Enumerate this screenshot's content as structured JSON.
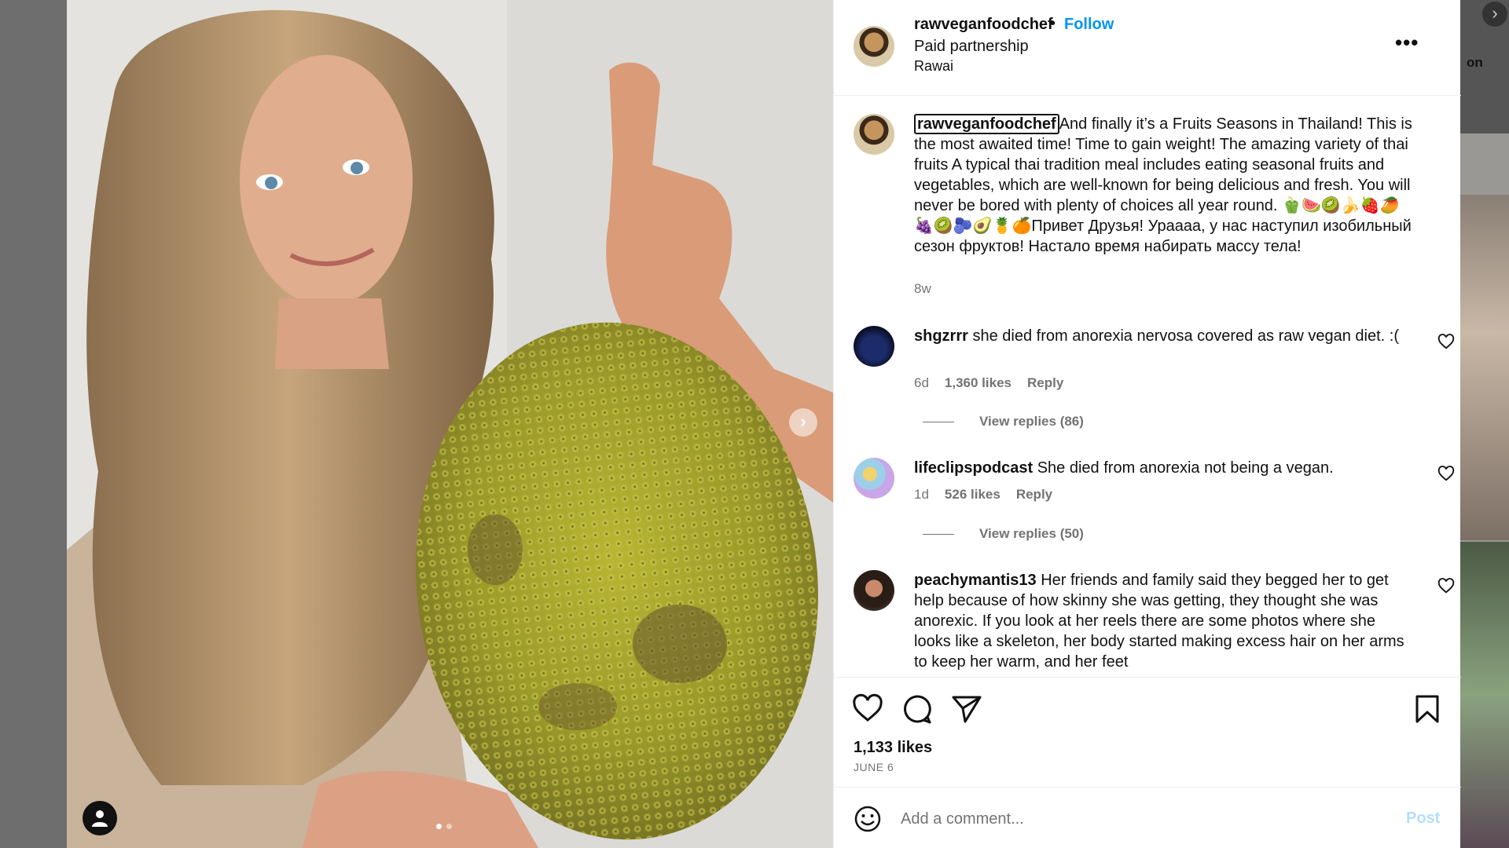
{
  "header": {
    "username": "rawveganfoodchef",
    "separator": "•",
    "follow_label": "Follow",
    "subtitle": "Paid partnership",
    "location": "Rawai",
    "more_label": "•••"
  },
  "caption": {
    "username": "rawveganfoodchef",
    "text": "And finally it’s a Fruits Seasons in Thailand! This is the most awaited time! Time to gain weight! The amazing variety of thai fruits A typical thai tradition meal includes eating seasonal fruits and vegetables, which are well-known for being delicious and fresh. You will never be bored with plenty of choices all year round. 🫑🍉🥝🍌🍓🥭🍇🥝🫐🥑🍍🍊Привет Друзья! Ураааа, у нас наступил изобильный сезон фруктов! Настало время набирать массу тела!",
    "age": "8w"
  },
  "comments": [
    {
      "username": "shgzrrr",
      "text": "she died from anorexia nervosa covered as raw vegan diet. :(",
      "age": "6d",
      "likes": "1,360 likes",
      "reply_label": "Reply",
      "view_replies": "View replies (86)"
    },
    {
      "username": "lifeclipspodcast",
      "text": "She died from anorexia not being a vegan.",
      "age": "1d",
      "likes": "526 likes",
      "reply_label": "Reply",
      "view_replies": "View replies (50)"
    },
    {
      "username": "peachymantis13",
      "text": "Her friends and family said they begged her to get help because of how skinny she was getting, they thought she was anorexic. If you look at her reels there are some photos where she looks like a skeleton, her body started making excess hair on her arms to keep her warm, and her feet"
    }
  ],
  "actions": {
    "likes": "1,133 likes",
    "date": "JUNE 6"
  },
  "comment_box": {
    "placeholder": "Add a comment...",
    "post_label": "Post"
  },
  "media": {
    "next_label": "›",
    "slide_count": 2,
    "active_slide": 1
  },
  "backdrop": {
    "side_text": "on",
    "side_icon": "›"
  },
  "colors": {
    "link_blue": "#0095f6",
    "post_disabled": "#b3dffc",
    "muted": "#737373"
  }
}
